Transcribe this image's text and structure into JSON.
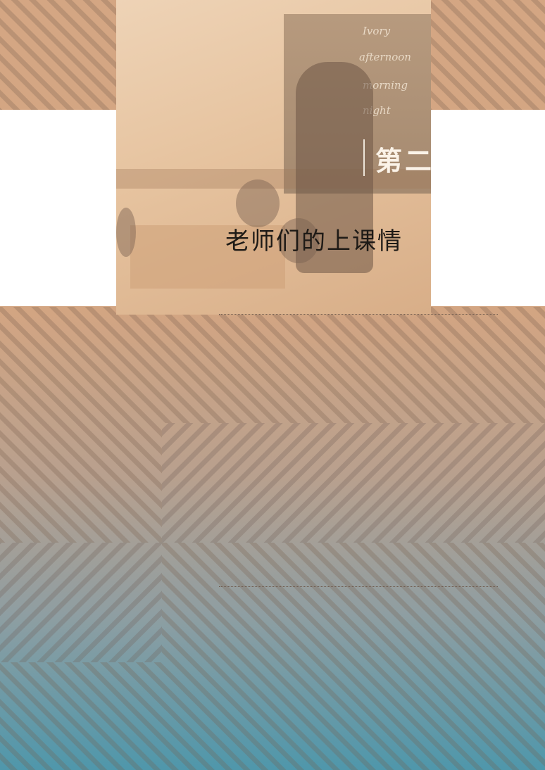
{
  "chapter": {
    "title": "第二"
  },
  "section": {
    "subtitle": "老师们的上课情"
  },
  "photo": {
    "chalk_words": [
      "Ivory",
      "afternoon",
      "morning",
      "night"
    ]
  },
  "colors": {
    "top_tan": "#d4a683",
    "bottom_teal": "#4f97ab",
    "stripe_dark": "#9a7a66",
    "title_light": "#fbf3e8",
    "subtitle_dark": "#1e1a16"
  }
}
